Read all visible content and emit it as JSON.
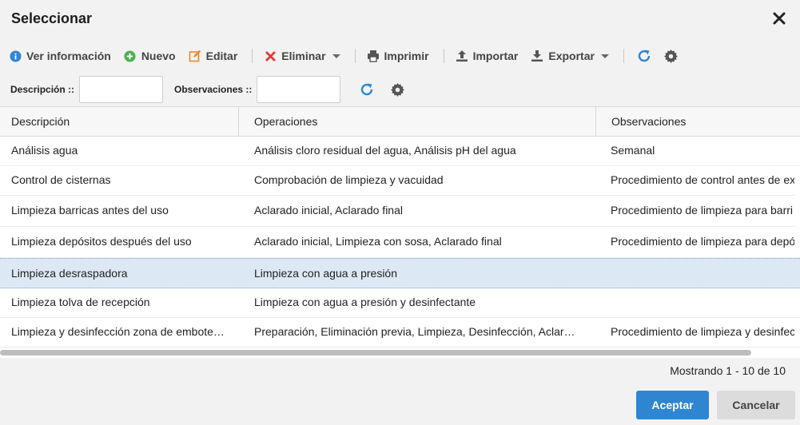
{
  "dialog": {
    "title": "Seleccionar",
    "close_icon": "close-icon"
  },
  "toolbar": {
    "info_label": "Ver información",
    "new_label": "Nuevo",
    "edit_label": "Editar",
    "delete_label": "Eliminar",
    "print_label": "Imprimir",
    "import_label": "Importar",
    "export_label": "Exportar",
    "icons": {
      "info": "info-icon",
      "new": "plus-circle-icon",
      "edit": "edit-icon",
      "delete": "x-icon",
      "print": "print-icon",
      "import": "upload-icon",
      "export": "download-icon",
      "refresh": "refresh-icon",
      "settings": "gear-icon"
    },
    "colors": {
      "info": "#2e86d3",
      "new": "#4caf50",
      "edit": "#f08a24",
      "delete": "#e53935",
      "refresh": "#2e86d3",
      "neutral": "#555555"
    }
  },
  "filters": {
    "description_label": "Descripción ::",
    "description_value": "",
    "observations_label": "Observaciones ::",
    "observations_value": ""
  },
  "grid": {
    "columns": [
      "Descripción",
      "Operaciones",
      "Observaciones"
    ],
    "rows": [
      {
        "descripcion": "Análisis agua",
        "operaciones": "Análisis cloro residual del agua, Análisis pH del agua",
        "observaciones": "Semanal",
        "selected": false
      },
      {
        "descripcion": "Control de cisternas",
        "operaciones": "Comprobación de limpieza y vacuidad",
        "observaciones": "Procedimiento de control antes de ex",
        "selected": false
      },
      {
        "descripcion": "Limpieza barricas antes del uso",
        "operaciones": "Aclarado inicial, Aclarado final",
        "observaciones": "Procedimiento de limpieza para barri",
        "selected": false
      },
      {
        "descripcion": "Limpieza depósitos después del uso",
        "operaciones": "Aclarado inicial, Limpieza con sosa, Aclarado final",
        "observaciones": "Procedimiento de limpieza para depó",
        "selected": false
      },
      {
        "descripcion": "Limpieza desraspadora",
        "operaciones": "Limpieza con agua a presión",
        "observaciones": "",
        "selected": true
      },
      {
        "descripcion": "Limpieza tolva de recepción",
        "operaciones": "Limpieza con agua a presión y desinfectante",
        "observaciones": "",
        "selected": false
      },
      {
        "descripcion": "Limpieza y desinfección zona de embote…",
        "operaciones": "Preparación, Eliminación previa, Limpieza, Desinfección, Aclara…",
        "observaciones": "Procedimiento de limpieza y desinfec",
        "selected": false
      }
    ]
  },
  "footer": {
    "paging_text": "Mostrando 1 - 10 de 10",
    "accept_label": "Aceptar",
    "cancel_label": "Cancelar",
    "accept_color": "#2e86d3"
  }
}
